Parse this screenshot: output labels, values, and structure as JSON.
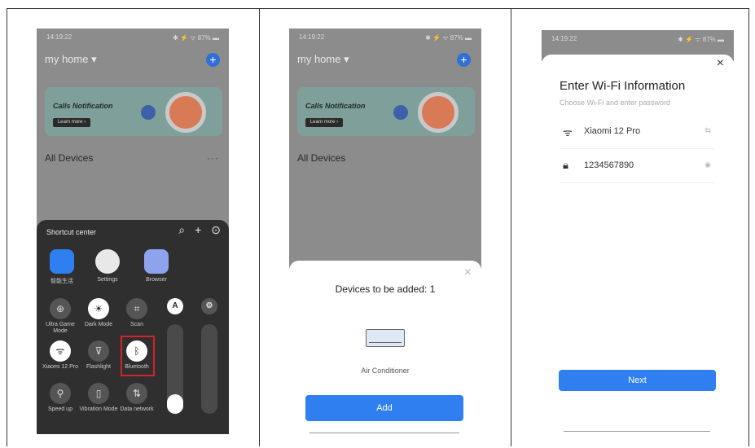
{
  "panel1": {
    "status_time": "14:19:22",
    "status_right": "✱ ⚡ ᯤ 87% ▬",
    "home_title": "my home ▾",
    "banner_title": "Calls Notification",
    "banner_button": "Learn more ›",
    "all_devices": "All Devices",
    "more": "···",
    "shortcut_title": "Shortcut center",
    "apps": [
      {
        "label": "智能生活"
      },
      {
        "label": "Settings"
      },
      {
        "label": "Browser"
      }
    ],
    "toggles": [
      {
        "label": "Ultra Game Mode",
        "glyph": "⊕"
      },
      {
        "label": "Dark Mode",
        "glyph": "☀"
      },
      {
        "label": "Scan",
        "glyph": "⌗"
      },
      {
        "label": "Xiaomi 12 Pro",
        "glyph": "ᯤ"
      },
      {
        "label": "Flashlight",
        "glyph": "⊽"
      },
      {
        "label": "Bluetooth",
        "glyph": "ᛒ"
      },
      {
        "label": "Speed up",
        "glyph": "⚲"
      },
      {
        "label": "Vibration Mode",
        "glyph": "▯"
      },
      {
        "label": "Data network",
        "glyph": "⇅"
      }
    ],
    "round_a": "A",
    "round_gear": "⚙"
  },
  "panel2": {
    "status_time": "14:19:22",
    "status_right": "✱ ⚡ ᯤ 87% ▬",
    "home_title": "my home ▾",
    "banner_title": "Calls Notification",
    "banner_button": "Learn more ›",
    "all_devices": "All Devices",
    "sheet_title": "Devices to be added: 1",
    "device_name": "Air Conditioner",
    "add_button": "Add"
  },
  "panel3": {
    "status_time": "14:19:22",
    "status_right": "✱ ⚡ ᯤ 87% ▬",
    "title": "Enter Wi-Fi Information",
    "subtitle": "Choose Wi-Fi and enter password",
    "wifi_name": "Xiaomi 12 Pro",
    "password": "1234567890",
    "next_button": "Next"
  },
  "colors": {
    "accent": "#2f7ff0",
    "highlight": "#d2242a"
  }
}
